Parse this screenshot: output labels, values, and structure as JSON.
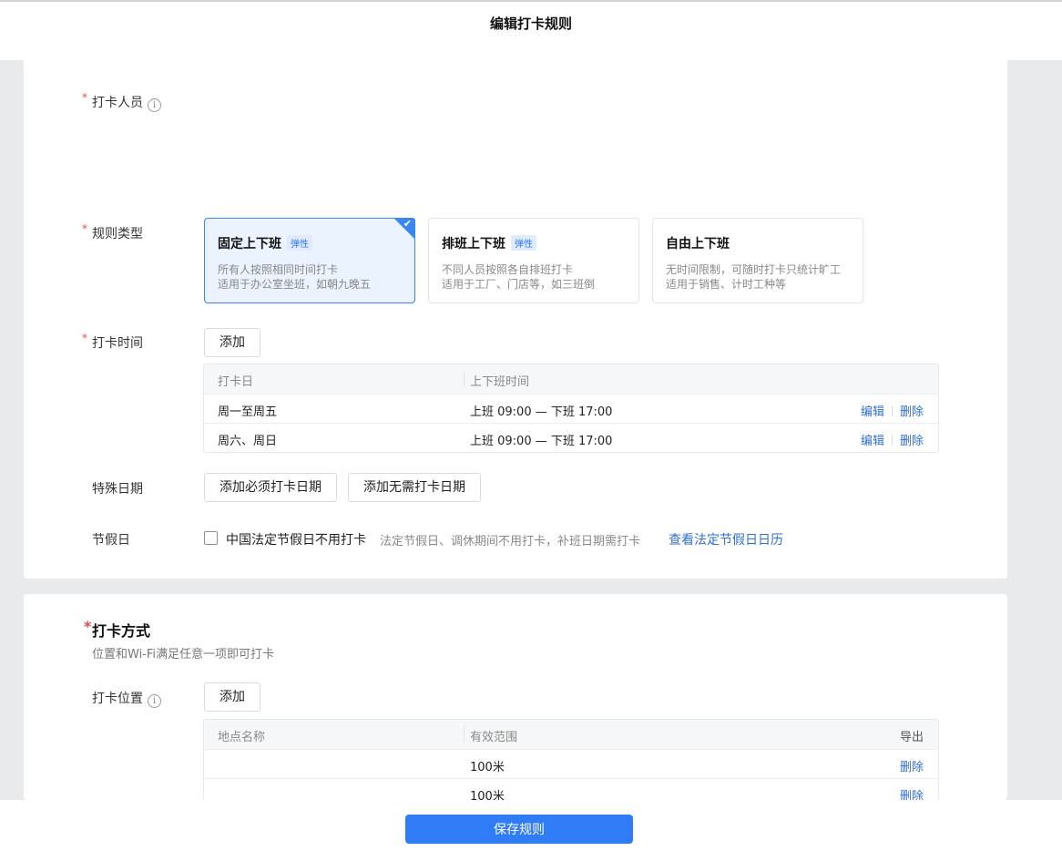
{
  "header": {
    "title": "编辑打卡规则"
  },
  "rules": {
    "members_label": "打卡人员",
    "rule_type_label": "规则类型",
    "rule_types": [
      {
        "title": "固定上下班",
        "tag": "弹性",
        "desc1": "所有人按照相同时间打卡",
        "desc2": "适用于办公室坐班，如朝九晚五",
        "selected": true
      },
      {
        "title": "排班上下班",
        "tag": "弹性",
        "desc1": "不同人员按照各自排班打卡",
        "desc2": "适用于工厂、门店等，如三班倒",
        "selected": false
      },
      {
        "title": "自由上下班",
        "tag": "",
        "desc1": "无时间限制，可随时打卡只统计旷工",
        "desc2": "适用于销售、计时工种等",
        "selected": false
      }
    ],
    "time_label": "打卡时间",
    "add_label": "添加",
    "time_table": {
      "headers": [
        "打卡日",
        "上下班时间"
      ],
      "rows": [
        {
          "day": "周一至周五",
          "time": "上班 09:00 — 下班 17:00",
          "edit": "编辑",
          "delete": "删除"
        },
        {
          "day": "周六、周日",
          "time": "上班 09:00 — 下班 17:00",
          "edit": "编辑",
          "delete": "删除"
        }
      ]
    },
    "special_label": "特殊日期",
    "add_required_date": "添加必须打卡日期",
    "add_exempt_date": "添加无需打卡日期",
    "holiday_label": "节假日",
    "holiday_checkbox": "中国法定节假日不用打卡",
    "holiday_desc": "法定节假日、调休期间不用打卡，补班日期需打卡",
    "holiday_link": "查看法定节假日日历"
  },
  "method": {
    "title": "打卡方式",
    "subtitle": "位置和Wi-Fi满足任意一项即可打卡",
    "location_label": "打卡位置",
    "add_label": "添加",
    "location_table": {
      "headers": [
        "地点名称",
        "有效范围"
      ],
      "export": "导出",
      "rows": [
        {
          "name": "",
          "range": "100米",
          "delete": "删除"
        },
        {
          "name": "",
          "range": "100米",
          "delete": "删除"
        }
      ]
    }
  },
  "footer": {
    "save_label": "保存规则"
  },
  "colors": {
    "primary": "#2f7cf6",
    "link": "#2f6fd6",
    "required": "#e5484d",
    "selected_bg": "#eaf3ff"
  },
  "icons": {
    "info": "info-icon",
    "check": "check-icon"
  }
}
